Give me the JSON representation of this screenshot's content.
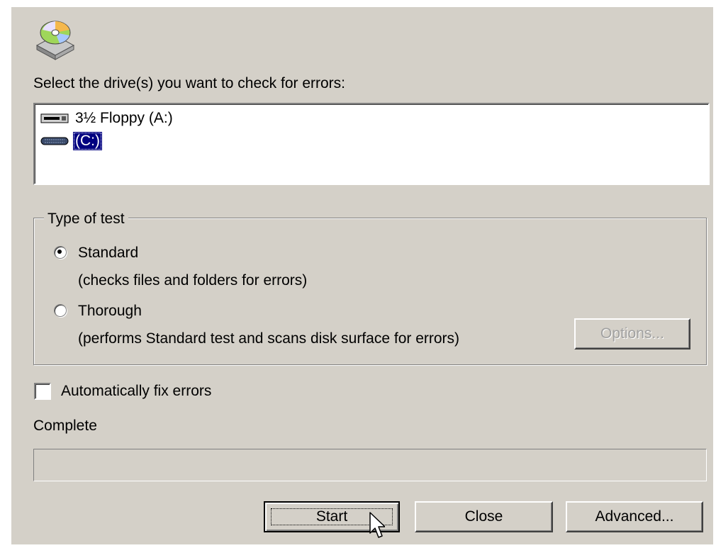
{
  "prompt": "Select the drive(s) you want to check for errors:",
  "drives": [
    {
      "label": "3½ Floppy (A:)",
      "icon": "floppy-drive-icon",
      "selected": false
    },
    {
      "label": "(C:)",
      "icon": "hard-drive-icon",
      "selected": true
    }
  ],
  "test_type": {
    "title": "Type of test",
    "options": [
      {
        "label": "Standard",
        "description": "(checks files and folders for errors)",
        "checked": true
      },
      {
        "label": "Thorough",
        "description": "(performs Standard test and scans disk surface for errors)",
        "checked": false
      }
    ],
    "options_button": "Options..."
  },
  "auto_fix": {
    "label": "Automatically fix errors",
    "checked": false
  },
  "status": {
    "label": "Complete",
    "progress": 0
  },
  "buttons": {
    "start": "Start",
    "close": "Close",
    "advanced": "Advanced..."
  },
  "colors": {
    "dialog": "#d4d0c8",
    "selection": "#000080"
  },
  "icons": {
    "app": "disk-check-icon",
    "cursor": "mouse-pointer-icon"
  }
}
